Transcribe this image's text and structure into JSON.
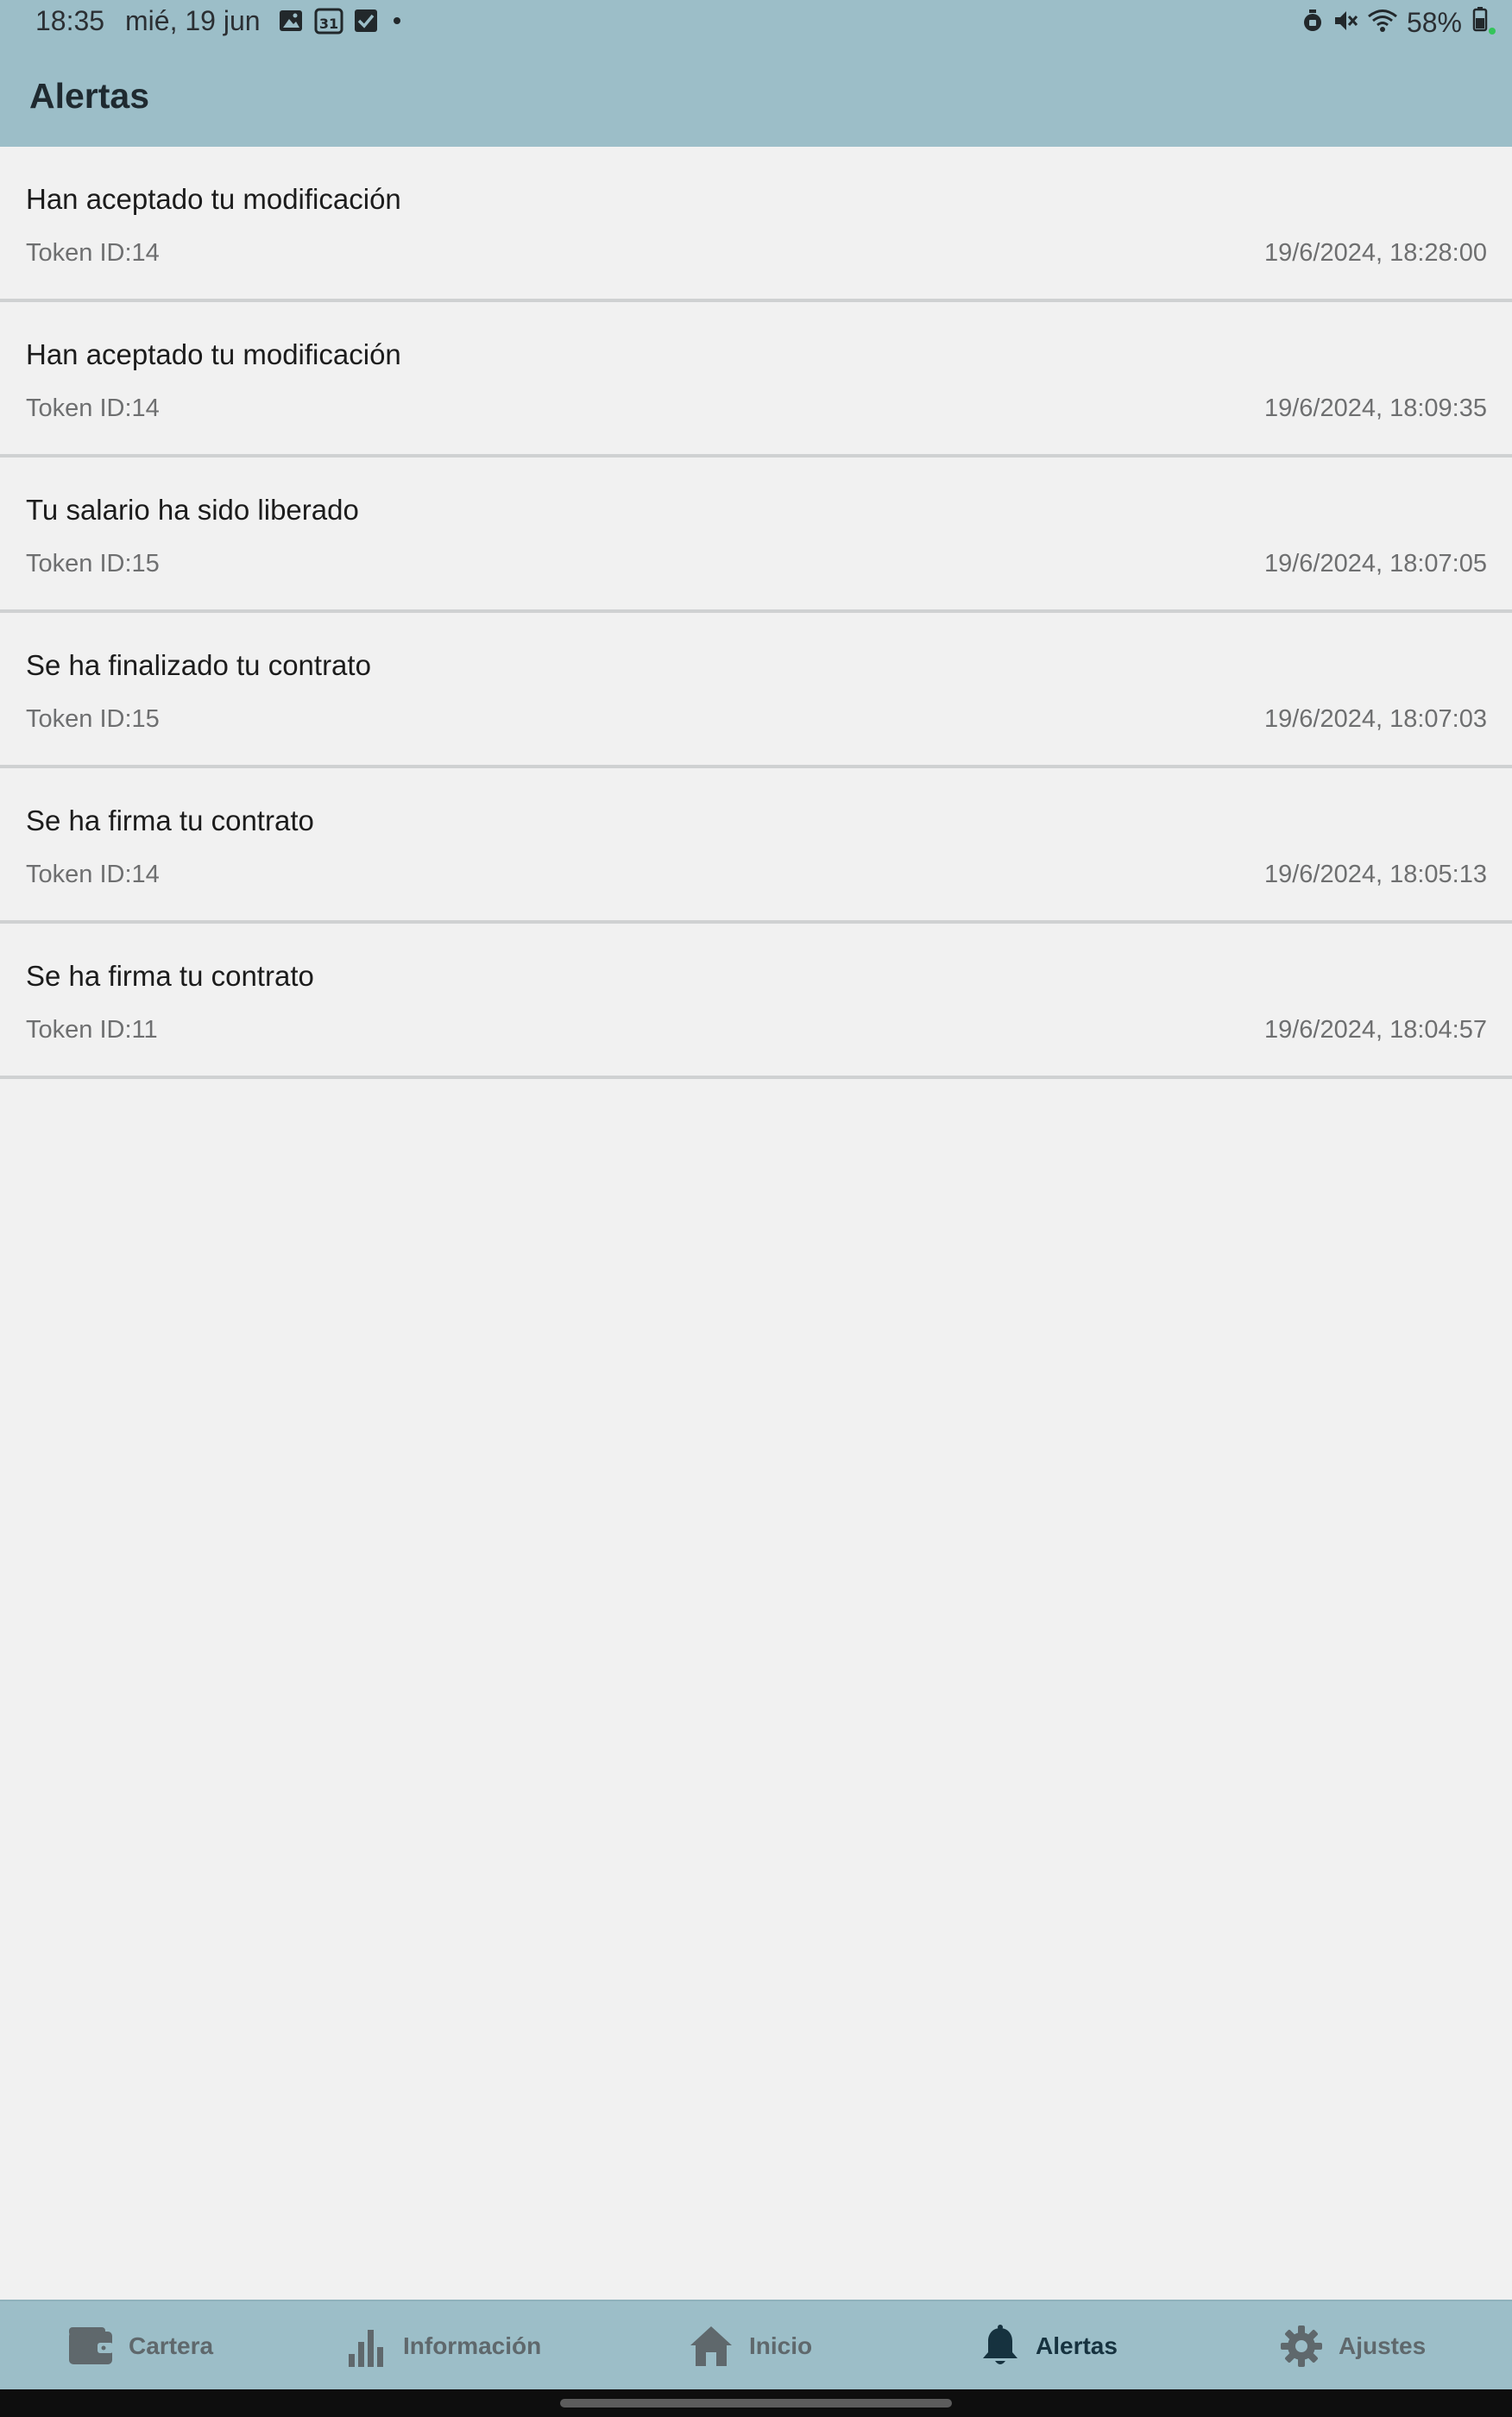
{
  "status_bar": {
    "time": "18:35",
    "date": "mié, 19 jun",
    "calendar_day": "31",
    "battery_percent": "58%",
    "icons_left": [
      "gallery-icon",
      "calendar-icon",
      "checkbox-icon",
      "dot-icon"
    ],
    "icons_right": [
      "alarm-icon",
      "mute-icon",
      "wifi-icon",
      "battery-icon"
    ]
  },
  "header": {
    "title": "Alertas"
  },
  "alerts": [
    {
      "title": "Han aceptado tu modificación",
      "token": "Token ID:14",
      "datetime": "19/6/2024, 18:28:00"
    },
    {
      "title": "Han aceptado tu modificación",
      "token": "Token ID:14",
      "datetime": "19/6/2024, 18:09:35"
    },
    {
      "title": "Tu salario ha sido liberado",
      "token": "Token ID:15",
      "datetime": "19/6/2024, 18:07:05"
    },
    {
      "title": "Se ha finalizado tu contrato",
      "token": "Token ID:15",
      "datetime": "19/6/2024, 18:07:03"
    },
    {
      "title": "Se ha firma tu contrato",
      "token": "Token ID:14",
      "datetime": "19/6/2024, 18:05:13"
    },
    {
      "title": "Se ha firma tu contrato",
      "token": "Token ID:11",
      "datetime": "19/6/2024, 18:04:57"
    }
  ],
  "bottom_nav": {
    "items": [
      {
        "label": "Cartera",
        "icon": "wallet-icon",
        "active": false
      },
      {
        "label": "Información",
        "icon": "bar-chart-icon",
        "active": false
      },
      {
        "label": "Inicio",
        "icon": "home-icon",
        "active": false
      },
      {
        "label": "Alertas",
        "icon": "bell-icon",
        "active": true
      },
      {
        "label": "Ajustes",
        "icon": "gear-icon",
        "active": false
      }
    ]
  },
  "colors": {
    "header_bg": "#9cbec8",
    "page_bg": "#f1f1f1",
    "nav_active": "#16323f",
    "nav_inactive": "#5f686c"
  }
}
